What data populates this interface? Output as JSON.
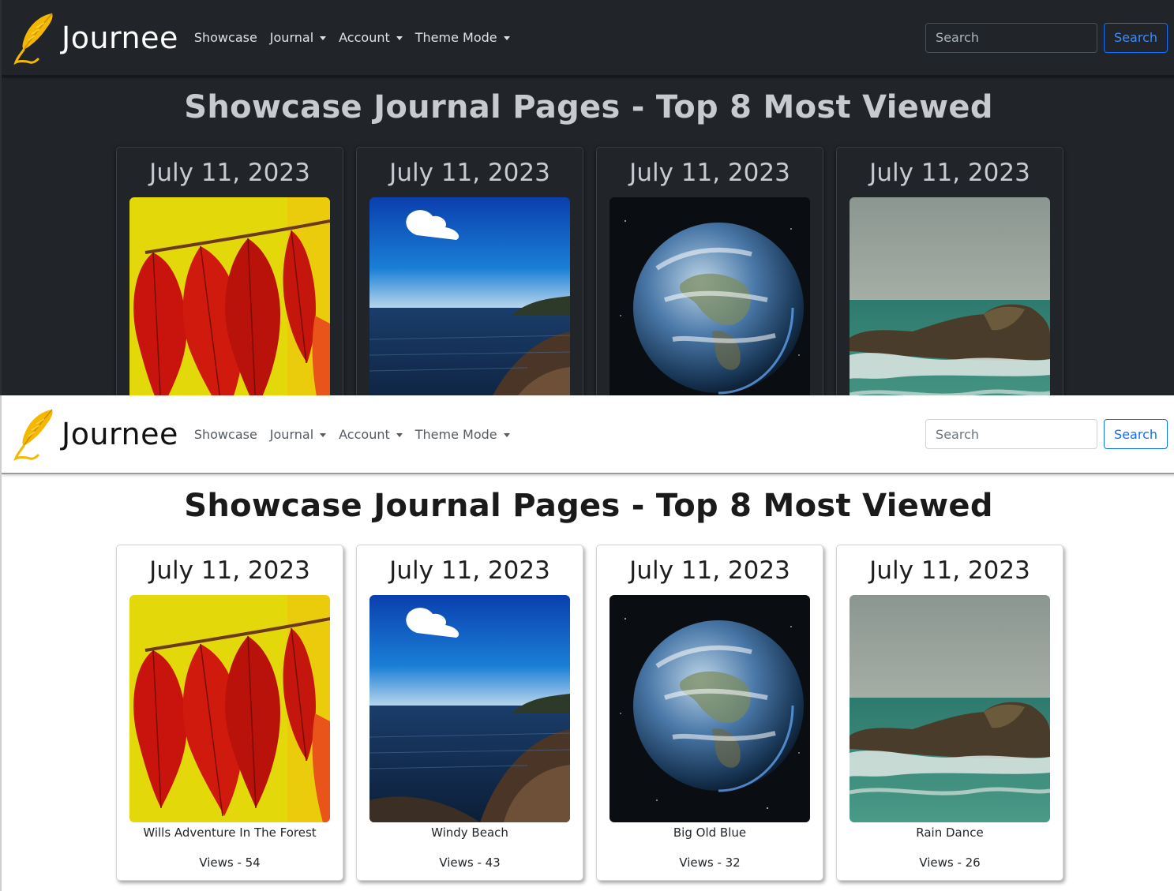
{
  "colors": {
    "dark_background": "#212529",
    "light_background": "#ffffff",
    "accent": "#0d6efd",
    "quill": "#f5b800"
  },
  "brand": {
    "name": "Journee",
    "logo_icon": "quill-feather-icon"
  },
  "nav": {
    "showcase": "Showcase",
    "journal": "Journal",
    "account": "Account",
    "theme_mode": "Theme Mode"
  },
  "search": {
    "placeholder": "Search",
    "button": "Search"
  },
  "page_title": "Showcase Journal Pages - Top 8 Most Viewed",
  "cards": [
    {
      "date": "July 11, 2023",
      "title": "Wills Adventure In The Forest",
      "views": "Views - 54",
      "image": "red-autumn-leaves-photo"
    },
    {
      "date": "July 11, 2023",
      "title": "Windy Beach",
      "views": "Views - 43",
      "image": "sea-coast-blue-sky-photo"
    },
    {
      "date": "July 11, 2023",
      "title": "Big Old Blue",
      "views": "Views - 32",
      "image": "earth-from-space-photo"
    },
    {
      "date": "July 11, 2023",
      "title": "Rain Dance",
      "views": "Views - 26",
      "image": "rock-in-sea-waves-photo"
    }
  ]
}
